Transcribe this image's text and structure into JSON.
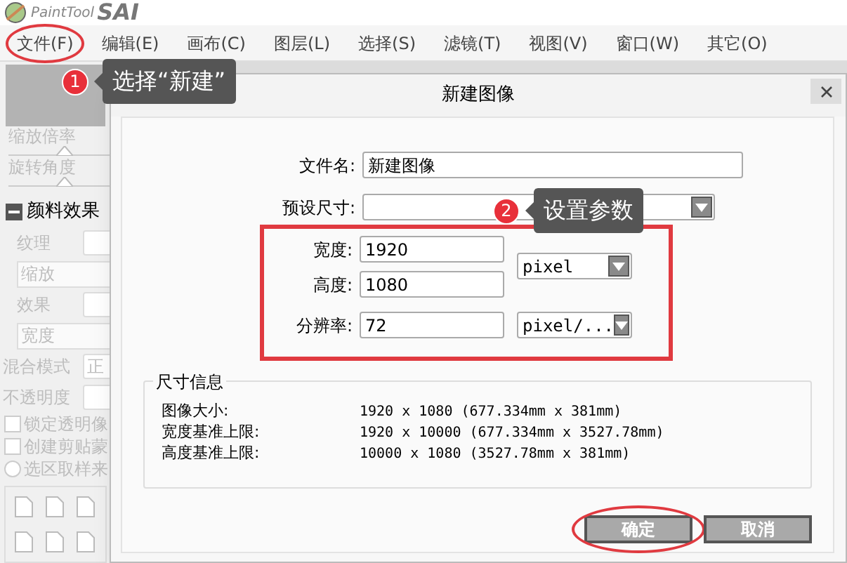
{
  "logo": {
    "text": "PaintTool",
    "mark": "SAI"
  },
  "menu": [
    {
      "label": "文件(F)",
      "circled": true
    },
    {
      "label": "编辑(E)",
      "circled": false
    },
    {
      "label": "画布(C)",
      "circled": false
    },
    {
      "label": "图层(L)",
      "circled": false
    },
    {
      "label": "选择(S)",
      "circled": false
    },
    {
      "label": "滤镜(T)",
      "circled": false
    },
    {
      "label": "视图(V)",
      "circled": false
    },
    {
      "label": "窗口(W)",
      "circled": false
    },
    {
      "label": "其它(O)",
      "circled": false
    }
  ],
  "panel": [
    {
      "kind": "slider",
      "label": "缩放倍率",
      "level": 0.55
    },
    {
      "kind": "slider",
      "label": "旋转角度",
      "level": 0.55
    },
    {
      "kind": "header",
      "label": "颜料效果",
      "expanded": true
    },
    {
      "kind": "combo",
      "label": "纹理"
    },
    {
      "kind": "field",
      "label": "缩放"
    },
    {
      "kind": "combo",
      "label": "效果"
    },
    {
      "kind": "field",
      "label": "宽度"
    },
    {
      "kind": "setting",
      "label": "混合模式",
      "value": "正"
    },
    {
      "kind": "setting",
      "label": "不透明度"
    },
    {
      "kind": "checkbox",
      "label": "锁定透明像",
      "checked": false
    },
    {
      "kind": "checkbox",
      "label": "创建剪贴蒙",
      "checked": false
    },
    {
      "kind": "radio",
      "label": "选区取样来",
      "checked": false
    }
  ],
  "dialog": {
    "title": "新建图像",
    "file_name": {
      "label": "文件名:",
      "value": "新建图像"
    },
    "preset": {
      "label": "预设尺寸:"
    },
    "width": {
      "label": "宽度:",
      "value": "1920"
    },
    "height": {
      "label": "高度:",
      "value": "1080"
    },
    "size_unit": "pixel",
    "resolution": {
      "label": "分辨率:",
      "value": "72",
      "unit": "pixel/..."
    },
    "info": {
      "title": "尺寸信息",
      "rows": [
        {
          "label": "图像大小:",
          "value": "1920 x 1080 (677.334mm x 381mm)"
        },
        {
          "label": "宽度基准上限:",
          "value": "1920 x 10000 (677.334mm x 3527.78mm)"
        },
        {
          "label": "高度基准上限:",
          "value": "10000 x 1080 (3527.78mm x 381mm)"
        }
      ]
    },
    "buttons": [
      {
        "label": "确定",
        "circled": true
      },
      {
        "label": "取消",
        "circled": false
      }
    ]
  },
  "annotations": [
    {
      "number": "1",
      "text": "选择“新建”"
    },
    {
      "number": "2",
      "text": "设置参数"
    }
  ]
}
